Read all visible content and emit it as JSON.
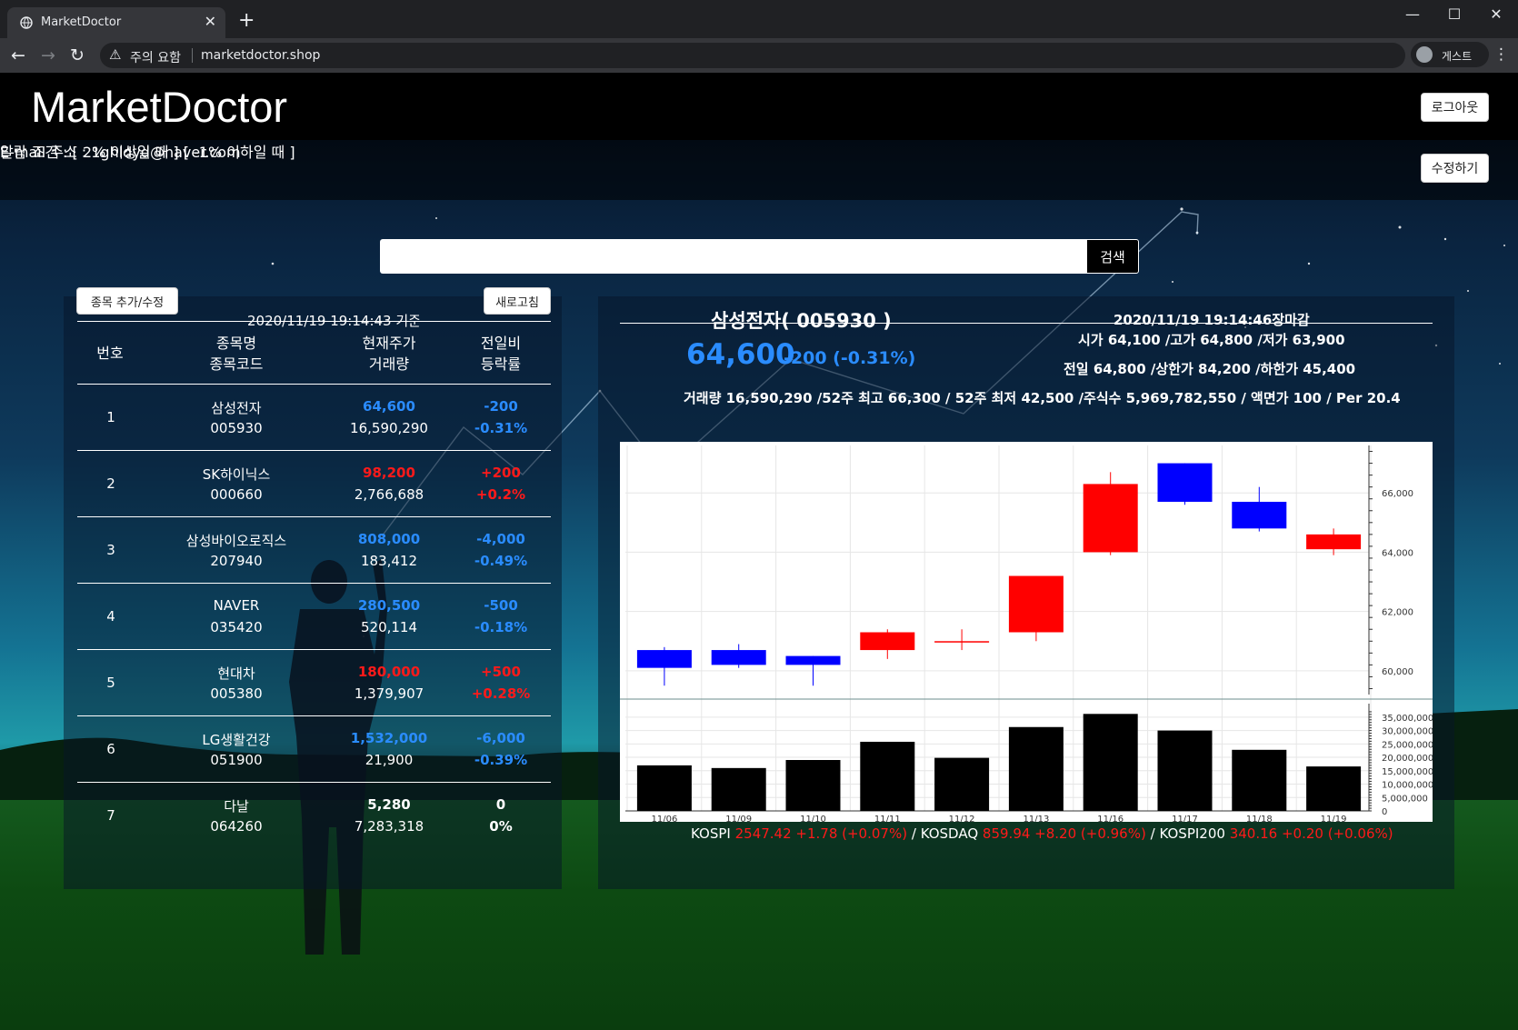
{
  "browser": {
    "tab_title": "MarketDoctor",
    "new_tab": "+",
    "security_label": "주의 요함",
    "url": "marketdoctor.shop",
    "profile_name": "게스트"
  },
  "header": {
    "logo": "MarketDoctor",
    "logout_label": "로그아웃"
  },
  "user": {
    "email_line": "E-mail 주소 : 1ghldyd@naver.com",
    "alarm_line": "알람 조건 : [ 2% 이상일 때 ] [ -1% 이하일 때 ]",
    "edit_label": "수정하기"
  },
  "search": {
    "value": "",
    "button_label": "검색"
  },
  "watchlist": {
    "add_label": "종목 추가/수정",
    "timestamp": "2020/11/19 19:14:43 기준",
    "refresh_label": "새로고침",
    "headers": {
      "no": "번호",
      "name": "종목명",
      "code": "종목코드",
      "price": "현재주가",
      "volume": "거래량",
      "diff": "전일비",
      "rate": "등락률"
    },
    "rows": [
      {
        "no": "1",
        "name": "삼성전자",
        "code": "005930",
        "price": "64,600",
        "volume": "16,590,290",
        "diff": "-200",
        "rate": "-0.31%",
        "dir": "blue"
      },
      {
        "no": "2",
        "name": "SK하이닉스",
        "code": "000660",
        "price": "98,200",
        "volume": "2,766,688",
        "diff": "+200",
        "rate": "+0.2%",
        "dir": "red"
      },
      {
        "no": "3",
        "name": "삼성바이오로직스",
        "code": "207940",
        "price": "808,000",
        "volume": "183,412",
        "diff": "-4,000",
        "rate": "-0.49%",
        "dir": "blue"
      },
      {
        "no": "4",
        "name": "NAVER",
        "code": "035420",
        "price": "280,500",
        "volume": "520,114",
        "diff": "-500",
        "rate": "-0.18%",
        "dir": "blue"
      },
      {
        "no": "5",
        "name": "현대차",
        "code": "005380",
        "price": "180,000",
        "volume": "1,379,907",
        "diff": "+500",
        "rate": "+0.28%",
        "dir": "red"
      },
      {
        "no": "6",
        "name": "LG생활건강",
        "code": "051900",
        "price": "1,532,000",
        "volume": "21,900",
        "diff": "-6,000",
        "rate": "-0.39%",
        "dir": "blue"
      },
      {
        "no": "7",
        "name": "다날",
        "code": "064260",
        "price": "5,280",
        "volume": "7,283,318",
        "diff": "0",
        "rate": "0%",
        "dir": "white"
      }
    ]
  },
  "detail": {
    "title": "삼성전자( 005930 )",
    "time": "2020/11/19 19:14:46장마감",
    "price": "64,600",
    "change": "-200 (-0.31%)",
    "ohl": "시가 64,100 /고가 64,800 /저가 63,900",
    "limits": "전일 64,800 /상한가 84,200 /하한가 45,400",
    "stats": "거래량 16,590,290 /52주 최고 66,300 / 52주 최저 42,500 /주식수 5,969,782,550 / 액면가 100 / Per 20.4"
  },
  "colors": {
    "up": "#ff0000",
    "down": "#0000ff",
    "accent_blue": "#2a8cff",
    "volume_bar": "#000000"
  },
  "chart_data": {
    "type": "candlestick",
    "categories": [
      "11/06",
      "11/09",
      "11/10",
      "11/11",
      "11/12",
      "11/13",
      "11/16",
      "11/17",
      "11/18",
      "11/19"
    ],
    "ohlc": [
      {
        "open": 60700,
        "high": 60800,
        "low": 59500,
        "close": 60100
      },
      {
        "open": 60700,
        "high": 60900,
        "low": 60100,
        "close": 60200
      },
      {
        "open": 60500,
        "high": 60500,
        "low": 59500,
        "close": 60200
      },
      {
        "open": 60700,
        "high": 61400,
        "low": 60400,
        "close": 61300
      },
      {
        "open": 61000,
        "high": 61400,
        "low": 60700,
        "close": 61000
      },
      {
        "open": 61300,
        "high": 63200,
        "low": 61000,
        "close": 63200
      },
      {
        "open": 64000,
        "high": 66700,
        "low": 63900,
        "close": 66300
      },
      {
        "open": 67000,
        "high": 67000,
        "low": 65600,
        "close": 65700
      },
      {
        "open": 65700,
        "high": 66200,
        "low": 64700,
        "close": 64800
      },
      {
        "open": 64100,
        "high": 64800,
        "low": 63900,
        "close": 64600
      }
    ],
    "price_ticks": [
      "60,000",
      "62,000",
      "64,000",
      "66,000"
    ],
    "price_ylim": [
      59200,
      67600
    ],
    "volume": [
      17000000,
      16000000,
      19000000,
      25800000,
      19800000,
      31300000,
      36200000,
      30000000,
      22800000,
      16590290
    ],
    "volume_ticks": [
      "0",
      "5,000,000",
      "10,000,000",
      "15,000,000",
      "20,000,000",
      "25,000,000",
      "30,000,000",
      "35,000,000"
    ],
    "volume_ylim": [
      0,
      38000000
    ]
  },
  "indices": {
    "kospi_label": "KOSPI",
    "kospi_value": "2547.42 +1.78 (+0.07%)",
    "sep1": "/",
    "kosdaq_label": "KOSDAQ",
    "kosdaq_value": "859.94 +8.20 (+0.96%)",
    "sep2": "/",
    "kospi200_label": "KOSPI200",
    "kospi200_value": "340.16 +0.20 (+0.06%)"
  }
}
